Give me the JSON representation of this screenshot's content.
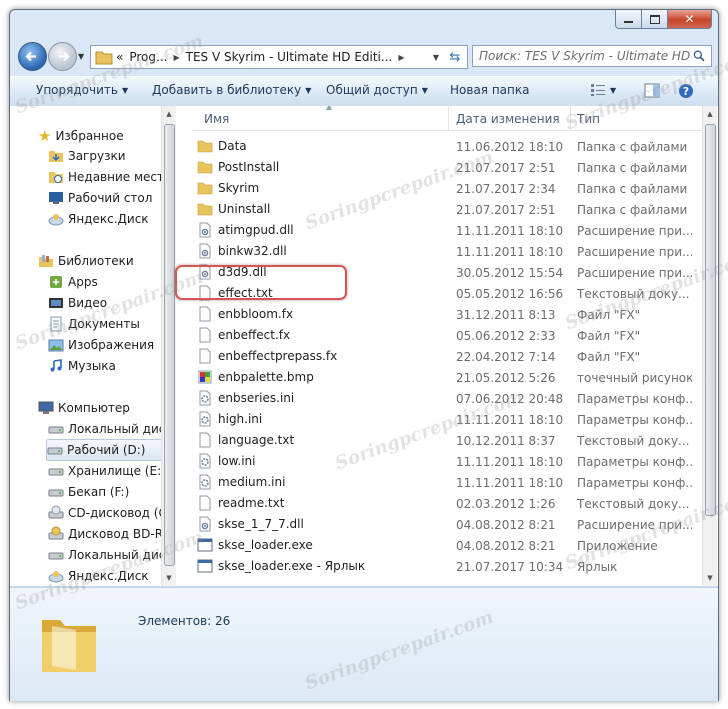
{
  "address": {
    "prefix": "«",
    "segments": [
      "Prog...",
      "TES V Skyrim - Ultimate HD Editi..."
    ]
  },
  "search": {
    "placeholder": "Поиск: TES V Skyrim - Ultimate HD Ed..."
  },
  "toolbar": {
    "organize": "Упорядочить",
    "add_library": "Добавить в библиотеку",
    "share": "Общий доступ",
    "new_folder": "Новая папка"
  },
  "nav": {
    "favorites": {
      "label": "Избранное",
      "items": [
        "Загрузки",
        "Недавние места",
        "Рабочий стол",
        "Яндекс.Диск"
      ]
    },
    "libraries": {
      "label": "Библиотеки",
      "items": [
        "Apps",
        "Видео",
        "Документы",
        "Изображения",
        "Музыка"
      ]
    },
    "computer": {
      "label": "Компьютер",
      "items": [
        "Локальный диск",
        "Рабочий (D:)",
        "Хранилище (E:)",
        "Бекап (F:)",
        "CD-дисковод (G:",
        "Дисковод BD-RO",
        "Локальный диск",
        "Яндекс.Диск"
      ]
    }
  },
  "columns": {
    "name": "Имя",
    "date": "Дата изменения",
    "type": "Тип"
  },
  "files": [
    {
      "name": "Data",
      "date": "11.06.2012 18:10",
      "type": "Папка с файлами",
      "icon": "folder"
    },
    {
      "name": "PostInstall",
      "date": "21.07.2017 2:51",
      "type": "Папка с файлами",
      "icon": "folder"
    },
    {
      "name": "Skyrim",
      "date": "21.07.2017 2:34",
      "type": "Папка с файлами",
      "icon": "folder"
    },
    {
      "name": "Uninstall",
      "date": "21.07.2017 2:51",
      "type": "Папка с файлами",
      "icon": "folder"
    },
    {
      "name": "atimgpud.dll",
      "date": "11.11.2011 18:10",
      "type": "Расширение при...",
      "icon": "dll"
    },
    {
      "name": "binkw32.dll",
      "date": "11.11.2011 18:10",
      "type": "Расширение при...",
      "icon": "dll"
    },
    {
      "name": "d3d9.dll",
      "date": "30.05.2012 15:54",
      "type": "Расширение при...",
      "icon": "dll"
    },
    {
      "name": "effect.txt",
      "date": "05.05.2012 16:56",
      "type": "Текстовый доку...",
      "icon": "file"
    },
    {
      "name": "enbbloom.fx",
      "date": "31.12.2011 8:13",
      "type": "Файл \"FX\"",
      "icon": "file"
    },
    {
      "name": "enbeffect.fx",
      "date": "05.06.2012 2:33",
      "type": "Файл \"FX\"",
      "icon": "file"
    },
    {
      "name": "enbeffectprepass.fx",
      "date": "22.04.2012 7:14",
      "type": "Файл \"FX\"",
      "icon": "file"
    },
    {
      "name": "enbpalette.bmp",
      "date": "21.05.2012 5:26",
      "type": "точечный рисунок",
      "icon": "bmp"
    },
    {
      "name": "enbseries.ini",
      "date": "07.06.2012 20:48",
      "type": "Параметры конф...",
      "icon": "ini"
    },
    {
      "name": "high.ini",
      "date": "11.11.2011 18:10",
      "type": "Параметры конф...",
      "icon": "ini"
    },
    {
      "name": "language.txt",
      "date": "10.12.2011 8:37",
      "type": "Текстовый доку...",
      "icon": "file"
    },
    {
      "name": "low.ini",
      "date": "11.11.2011 18:10",
      "type": "Параметры конф...",
      "icon": "ini"
    },
    {
      "name": "medium.ini",
      "date": "11.11.2011 18:10",
      "type": "Параметры конф...",
      "icon": "ini"
    },
    {
      "name": "readme.txt",
      "date": "02.03.2012 1:26",
      "type": "Текстовый доку...",
      "icon": "file"
    },
    {
      "name": "skse_1_7_7.dll",
      "date": "04.08.2012 8:21",
      "type": "Расширение при...",
      "icon": "dll"
    },
    {
      "name": "skse_loader.exe",
      "date": "04.08.2012 8:21",
      "type": "Приложение",
      "icon": "exe"
    },
    {
      "name": "skse_loader.exe - Ярлык",
      "date": "21.07.2017 10:34",
      "type": "Ярлык",
      "icon": "exe"
    }
  ],
  "status": {
    "count": "Элементов: 26"
  },
  "watermark": "Soringpcrepair.com",
  "colors": {
    "highlight": "#d9534f",
    "folder": "#e9c45d"
  }
}
